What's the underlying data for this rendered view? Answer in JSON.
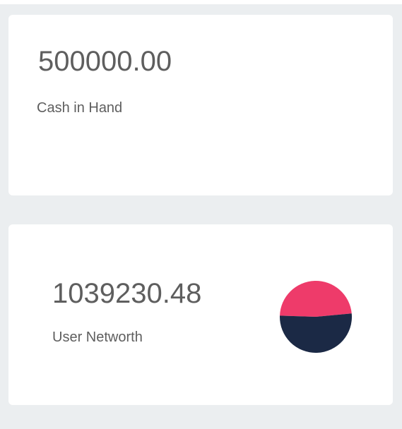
{
  "cards": [
    {
      "value": "500000.00",
      "label": "Cash in Hand"
    },
    {
      "value": "1039230.48",
      "label": "User Networth"
    }
  ],
  "networth_chart": {
    "type": "pie",
    "slices": [
      {
        "fraction": 0.48,
        "color": "#ee3b6a"
      },
      {
        "fraction": 0.52,
        "color": "#1b2945"
      }
    ]
  }
}
